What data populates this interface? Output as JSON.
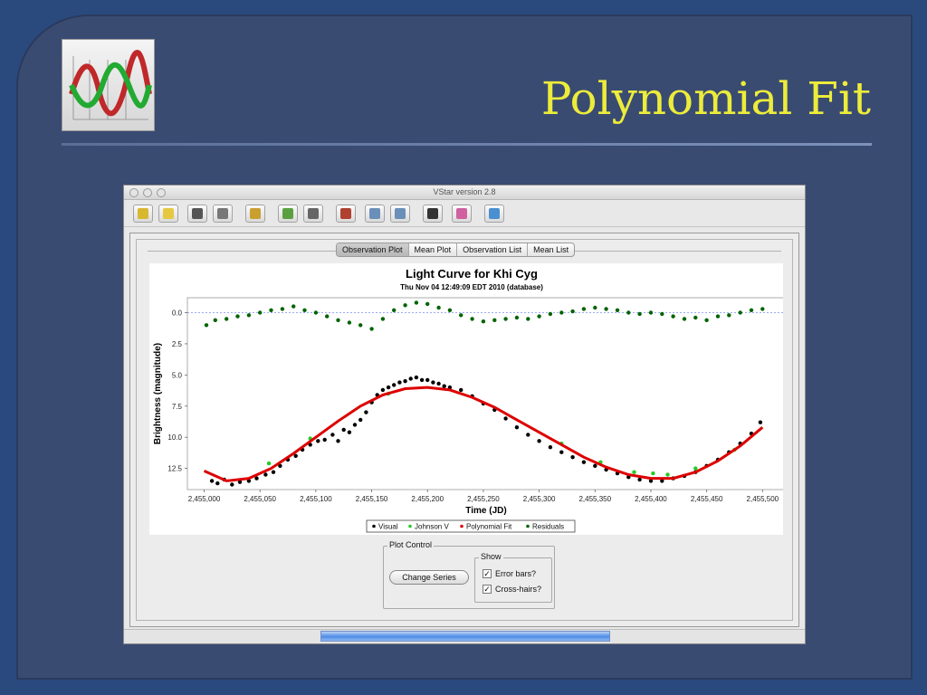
{
  "slide": {
    "title": "Polynomial Fit"
  },
  "window": {
    "title": "VStar version 2.8",
    "toolbar": [
      {
        "icon": "new-star-icon",
        "color": "#d8b830"
      },
      {
        "icon": "open-folder-icon",
        "color": "#e6c840"
      },
      {
        "icon": "save-icon",
        "color": "#555555"
      },
      {
        "icon": "print-icon",
        "color": "#777777"
      },
      {
        "icon": "info-icon",
        "color": "#c9a030"
      },
      {
        "icon": "raw-data-icon",
        "color": "#5aa040"
      },
      {
        "icon": "phase-plot-icon",
        "color": "#666666"
      },
      {
        "icon": "model-icon",
        "color": "#b04030"
      },
      {
        "icon": "zoom-in-icon",
        "color": "#6a8fb8"
      },
      {
        "icon": "zoom-out-icon",
        "color": "#6a8fb8"
      },
      {
        "icon": "filter-icon",
        "color": "#333333"
      },
      {
        "icon": "plugin-icon",
        "color": "#d060a0"
      },
      {
        "icon": "help-icon",
        "color": "#4a90d0"
      }
    ],
    "tabs": [
      {
        "label": "Observation Plot",
        "active": true
      },
      {
        "label": "Mean Plot",
        "active": false
      },
      {
        "label": "Observation List",
        "active": false
      },
      {
        "label": "Mean List",
        "active": false
      }
    ],
    "plot_control": {
      "legend": "Plot Control",
      "change_series": "Change Series",
      "show_legend": "Show",
      "error_bars": "Error bars?",
      "error_bars_checked": true,
      "cross_hairs": "Cross-hairs?",
      "cross_hairs_checked": true
    },
    "progress": 1.0
  },
  "chart_data": {
    "type": "scatter",
    "title": "Light Curve for Khi Cyg",
    "subtitle": "Thu Nov 04 12:49:09 EDT 2010 (database)",
    "xlabel": "Time (JD)",
    "ylabel": "Brightness (magnitude)",
    "xlim": [
      2454985,
      2455520
    ],
    "ylim": [
      -1.2,
      14.2
    ],
    "y_inverted": true,
    "xticks": [
      2455000,
      2455050,
      2455100,
      2455150,
      2455200,
      2455250,
      2455300,
      2455350,
      2455400,
      2455450,
      2455500
    ],
    "xtick_labels": [
      "2,455,000",
      "2,455,050",
      "2,455,100",
      "2,455,150",
      "2,455,200",
      "2,455,250",
      "2,455,300",
      "2,455,350",
      "2,455,400",
      "2,455,450",
      "2,455,500"
    ],
    "yticks": [
      0.0,
      2.5,
      5.0,
      7.5,
      10.0,
      12.5
    ],
    "ytick_labels": [
      "0.0",
      "2.5",
      "5.0",
      "7.5",
      "10.0",
      "12.5"
    ],
    "zero_line": 0.0,
    "legend": [
      {
        "name": "Visual",
        "color": "#000000"
      },
      {
        "name": "Johnson V",
        "color": "#22cc22"
      },
      {
        "name": "Polynomial Fit",
        "color": "#dd0000"
      },
      {
        "name": "Residuals",
        "color": "#006400"
      }
    ],
    "series": [
      {
        "name": "Visual",
        "color": "#000000",
        "points": [
          [
            2455007,
            13.5
          ],
          [
            2455012,
            13.7
          ],
          [
            2455018,
            13.4
          ],
          [
            2455025,
            13.8
          ],
          [
            2455032,
            13.6
          ],
          [
            2455040,
            13.5
          ],
          [
            2455047,
            13.3
          ],
          [
            2455055,
            13.0
          ],
          [
            2455062,
            12.8
          ],
          [
            2455068,
            12.3
          ],
          [
            2455075,
            11.8
          ],
          [
            2455082,
            11.5
          ],
          [
            2455088,
            11.0
          ],
          [
            2455095,
            10.6
          ],
          [
            2455102,
            10.3
          ],
          [
            2455108,
            10.2
          ],
          [
            2455115,
            9.8
          ],
          [
            2455120,
            10.3
          ],
          [
            2455125,
            9.4
          ],
          [
            2455130,
            9.6
          ],
          [
            2455135,
            9.0
          ],
          [
            2455140,
            8.6
          ],
          [
            2455145,
            8.0
          ],
          [
            2455150,
            7.2
          ],
          [
            2455155,
            6.6
          ],
          [
            2455160,
            6.2
          ],
          [
            2455165,
            6.0
          ],
          [
            2455170,
            5.8
          ],
          [
            2455175,
            5.6
          ],
          [
            2455180,
            5.5
          ],
          [
            2455185,
            5.3
          ],
          [
            2455190,
            5.2
          ],
          [
            2455195,
            5.4
          ],
          [
            2455200,
            5.4
          ],
          [
            2455205,
            5.6
          ],
          [
            2455210,
            5.7
          ],
          [
            2455215,
            5.9
          ],
          [
            2455220,
            6.0
          ],
          [
            2455230,
            6.2
          ],
          [
            2455240,
            6.7
          ],
          [
            2455250,
            7.3
          ],
          [
            2455260,
            7.8
          ],
          [
            2455270,
            8.5
          ],
          [
            2455280,
            9.2
          ],
          [
            2455290,
            9.8
          ],
          [
            2455300,
            10.3
          ],
          [
            2455310,
            10.8
          ],
          [
            2455320,
            11.2
          ],
          [
            2455330,
            11.6
          ],
          [
            2455340,
            12.0
          ],
          [
            2455350,
            12.3
          ],
          [
            2455360,
            12.6
          ],
          [
            2455370,
            12.9
          ],
          [
            2455380,
            13.2
          ],
          [
            2455390,
            13.4
          ],
          [
            2455400,
            13.5
          ],
          [
            2455410,
            13.5
          ],
          [
            2455420,
            13.3
          ],
          [
            2455430,
            13.1
          ],
          [
            2455440,
            12.8
          ],
          [
            2455450,
            12.3
          ],
          [
            2455460,
            11.8
          ],
          [
            2455470,
            11.2
          ],
          [
            2455480,
            10.5
          ],
          [
            2455490,
            9.7
          ],
          [
            2455498,
            8.8
          ]
        ]
      },
      {
        "name": "Johnson V",
        "color": "#22cc22",
        "points": [
          [
            2455058,
            12.1
          ],
          [
            2455095,
            10.1
          ],
          [
            2455165,
            6.5
          ],
          [
            2455320,
            10.5
          ],
          [
            2455355,
            12.0
          ],
          [
            2455385,
            12.8
          ],
          [
            2455402,
            12.9
          ],
          [
            2455415,
            13.0
          ],
          [
            2455440,
            12.5
          ],
          [
            2455475,
            11.0
          ]
        ]
      },
      {
        "name": "Polynomial Fit",
        "color": "#dd0000",
        "points": [
          [
            2455000,
            12.7
          ],
          [
            2455020,
            13.5
          ],
          [
            2455040,
            13.3
          ],
          [
            2455060,
            12.5
          ],
          [
            2455080,
            11.3
          ],
          [
            2455100,
            10.0
          ],
          [
            2455120,
            8.7
          ],
          [
            2455140,
            7.5
          ],
          [
            2455160,
            6.6
          ],
          [
            2455180,
            6.1
          ],
          [
            2455200,
            6.0
          ],
          [
            2455220,
            6.2
          ],
          [
            2455240,
            6.8
          ],
          [
            2455260,
            7.6
          ],
          [
            2455280,
            8.6
          ],
          [
            2455300,
            9.6
          ],
          [
            2455320,
            10.6
          ],
          [
            2455340,
            11.6
          ],
          [
            2455360,
            12.4
          ],
          [
            2455380,
            13.0
          ],
          [
            2455400,
            13.3
          ],
          [
            2455420,
            13.3
          ],
          [
            2455440,
            12.8
          ],
          [
            2455460,
            11.9
          ],
          [
            2455480,
            10.7
          ],
          [
            2455500,
            9.2
          ]
        ]
      },
      {
        "name": "Residuals",
        "color": "#006400",
        "points": [
          [
            2455002,
            1.0
          ],
          [
            2455010,
            0.6
          ],
          [
            2455020,
            0.5
          ],
          [
            2455030,
            0.3
          ],
          [
            2455040,
            0.2
          ],
          [
            2455050,
            0.0
          ],
          [
            2455060,
            -0.2
          ],
          [
            2455070,
            -0.3
          ],
          [
            2455080,
            -0.5
          ],
          [
            2455090,
            -0.2
          ],
          [
            2455100,
            0.0
          ],
          [
            2455110,
            0.3
          ],
          [
            2455120,
            0.6
          ],
          [
            2455130,
            0.8
          ],
          [
            2455140,
            1.0
          ],
          [
            2455150,
            1.3
          ],
          [
            2455160,
            0.5
          ],
          [
            2455170,
            -0.2
          ],
          [
            2455180,
            -0.6
          ],
          [
            2455190,
            -0.8
          ],
          [
            2455200,
            -0.7
          ],
          [
            2455210,
            -0.4
          ],
          [
            2455220,
            -0.2
          ],
          [
            2455230,
            0.2
          ],
          [
            2455240,
            0.5
          ],
          [
            2455250,
            0.7
          ],
          [
            2455260,
            0.6
          ],
          [
            2455270,
            0.5
          ],
          [
            2455280,
            0.4
          ],
          [
            2455290,
            0.5
          ],
          [
            2455300,
            0.3
          ],
          [
            2455310,
            0.1
          ],
          [
            2455320,
            0.0
          ],
          [
            2455330,
            -0.1
          ],
          [
            2455340,
            -0.3
          ],
          [
            2455350,
            -0.4
          ],
          [
            2455360,
            -0.3
          ],
          [
            2455370,
            -0.2
          ],
          [
            2455380,
            0.0
          ],
          [
            2455390,
            0.1
          ],
          [
            2455400,
            0.0
          ],
          [
            2455410,
            0.1
          ],
          [
            2455420,
            0.3
          ],
          [
            2455430,
            0.5
          ],
          [
            2455440,
            0.4
          ],
          [
            2455450,
            0.6
          ],
          [
            2455460,
            0.3
          ],
          [
            2455470,
            0.2
          ],
          [
            2455480,
            0.0
          ],
          [
            2455490,
            -0.2
          ],
          [
            2455500,
            -0.3
          ]
        ]
      }
    ]
  }
}
